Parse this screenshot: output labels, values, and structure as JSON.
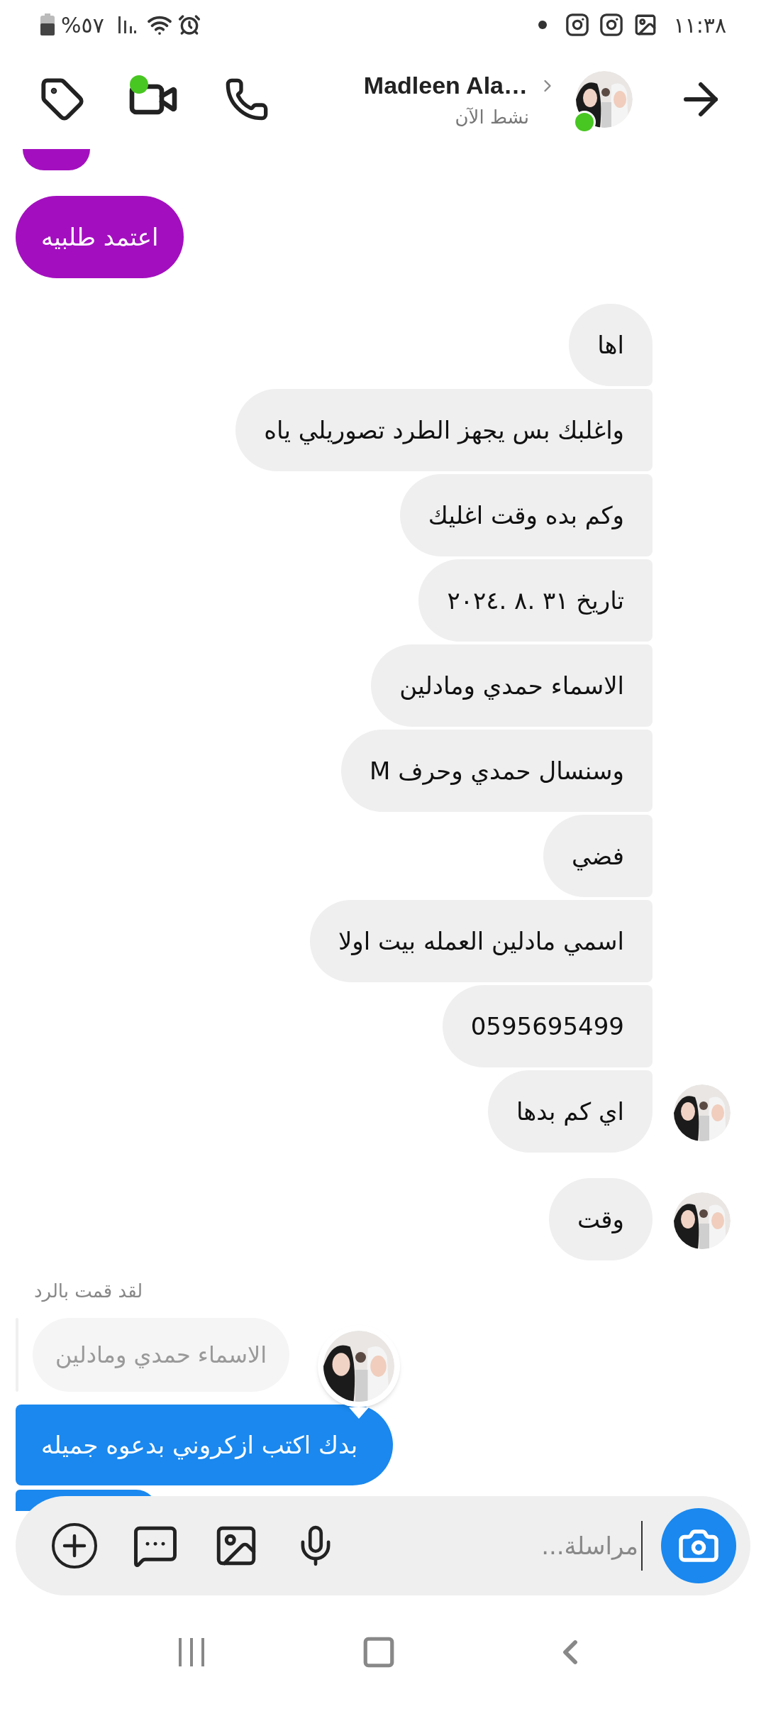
{
  "status_bar": {
    "battery": "%٥٧",
    "time": "١١:٣٨"
  },
  "header": {
    "name": "Madleen Ala…",
    "status": "نشط الآن",
    "online": true,
    "video_active": true
  },
  "messages": [
    {
      "kind": "cut"
    },
    {
      "kind": "sent",
      "text": "اعتمد طلبيه"
    },
    {
      "kind": "received",
      "text": "اها",
      "avatar": false
    },
    {
      "kind": "received",
      "text": "واغلبك بس يجهز الطرد تصوريلي ياه",
      "avatar": false
    },
    {
      "kind": "received",
      "text": "وكم بده وقت اغليك",
      "avatar": false
    },
    {
      "kind": "received",
      "text": "تاريخ ٣١ .٨ .٢٠٢٤",
      "avatar": false
    },
    {
      "kind": "received",
      "text": "الاسماء حمدي ومادلين",
      "avatar": false
    },
    {
      "kind": "received",
      "text": "وسنسال حمدي وحرف M",
      "avatar": false
    },
    {
      "kind": "received",
      "text": "فضي",
      "avatar": false
    },
    {
      "kind": "received",
      "text": "اسمي مادلين العمله بيت اولا",
      "avatar": false
    },
    {
      "kind": "received",
      "text": "0595695499",
      "avatar": false
    },
    {
      "kind": "received",
      "text": "اي  كم بدها",
      "avatar": true
    },
    {
      "kind": "gap"
    },
    {
      "kind": "received",
      "text": "وقت",
      "avatar": true
    }
  ],
  "reply": {
    "label": "لقد قمت بالرد",
    "quoted": "الاسماء حمدي ومادلين",
    "text": "بدك اكتب ازكروني بدعوه جميله",
    "seen": true
  },
  "composer": {
    "placeholder": "مراسلة..."
  }
}
